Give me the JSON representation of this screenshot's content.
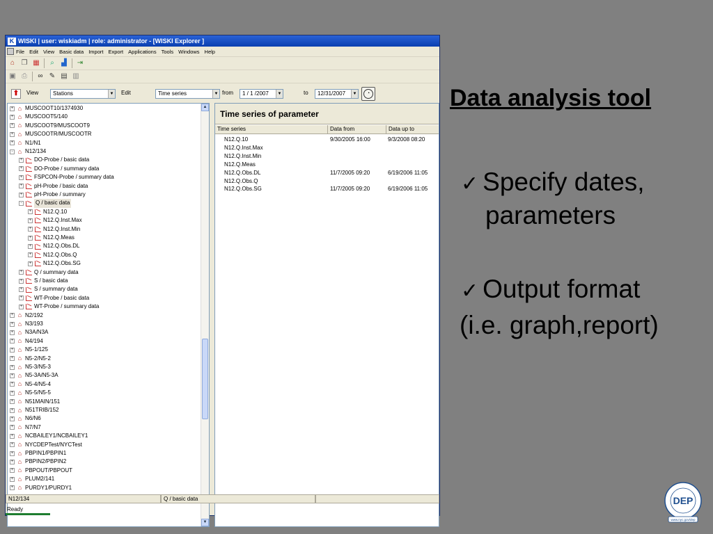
{
  "window": {
    "title": "WISKI | user: wiskiadm | role: administrator - [WISKI Explorer ]",
    "menu": [
      "File",
      "Edit",
      "View",
      "Basic data",
      "Import",
      "Export",
      "Applications",
      "Tools",
      "Windows",
      "Help"
    ]
  },
  "viewbar": {
    "view_label": "View",
    "view_value": "Stations",
    "edit_label": "Edit",
    "edit_value": "Time series",
    "from_label": "from",
    "from_value": "1 / 1 /2007",
    "to_label": "to",
    "to_value": "12/31/2007"
  },
  "tree": [
    {
      "label": "MUSCOOT10/1374930",
      "level": 0,
      "icon": "station",
      "exp": "+"
    },
    {
      "label": "MUSCOOT5/140",
      "level": 0,
      "icon": "station",
      "exp": "+"
    },
    {
      "label": "MUSCOOT9/MUSCOOT9",
      "level": 0,
      "icon": "station",
      "exp": "+"
    },
    {
      "label": "MUSCOOTR/MUSCOOTR",
      "level": 0,
      "icon": "station",
      "exp": "+"
    },
    {
      "label": "N1/N1",
      "level": 0,
      "icon": "station",
      "exp": "+"
    },
    {
      "label": "N12/134",
      "level": 0,
      "icon": "station",
      "exp": "-"
    },
    {
      "label": "DO-Probe / basic data",
      "level": 1,
      "icon": "series",
      "exp": "+"
    },
    {
      "label": "DO-Probe / summary data",
      "level": 1,
      "icon": "series",
      "exp": "+"
    },
    {
      "label": "FSPCON-Probe / summary data",
      "level": 1,
      "icon": "series",
      "exp": "+"
    },
    {
      "label": "pH-Probe / basic data",
      "level": 1,
      "icon": "series",
      "exp": "+"
    },
    {
      "label": "pH-Probe / summary",
      "level": 1,
      "icon": "series",
      "exp": "+"
    },
    {
      "label": "Q / basic data",
      "level": 1,
      "icon": "series",
      "exp": "-",
      "selected": true
    },
    {
      "label": "N12.Q.10",
      "level": 2,
      "icon": "series",
      "exp": "+"
    },
    {
      "label": "N12.Q.Inst.Max",
      "level": 2,
      "icon": "series",
      "exp": "+"
    },
    {
      "label": "N12.Q.Inst.Min",
      "level": 2,
      "icon": "series",
      "exp": "+"
    },
    {
      "label": "N12.Q.Meas",
      "level": 2,
      "icon": "series",
      "exp": "+"
    },
    {
      "label": "N12.Q.Obs.DL",
      "level": 2,
      "icon": "series",
      "exp": "+"
    },
    {
      "label": "N12.Q.Obs.Q",
      "level": 2,
      "icon": "series",
      "exp": "+"
    },
    {
      "label": "N12.Q.Obs.SG",
      "level": 2,
      "icon": "series",
      "exp": "+"
    },
    {
      "label": "Q / summary data",
      "level": 1,
      "icon": "series",
      "exp": "+"
    },
    {
      "label": "S / basic data",
      "level": 1,
      "icon": "series",
      "exp": "+"
    },
    {
      "label": "S / summary data",
      "level": 1,
      "icon": "series",
      "exp": "+"
    },
    {
      "label": "WT-Probe / basic data",
      "level": 1,
      "icon": "series",
      "exp": "+"
    },
    {
      "label": "WT-Probe / summary data",
      "level": 1,
      "icon": "series",
      "exp": "+"
    },
    {
      "label": "N2/192",
      "level": 0,
      "icon": "station",
      "exp": "+"
    },
    {
      "label": "N3/193",
      "level": 0,
      "icon": "station",
      "exp": "+"
    },
    {
      "label": "N3A/N3A",
      "level": 0,
      "icon": "station",
      "exp": "+"
    },
    {
      "label": "N4/194",
      "level": 0,
      "icon": "station",
      "exp": "+"
    },
    {
      "label": "N5-1/125",
      "level": 0,
      "icon": "station",
      "exp": "+"
    },
    {
      "label": "N5-2/N5-2",
      "level": 0,
      "icon": "station",
      "exp": "+"
    },
    {
      "label": "N5-3/N5-3",
      "level": 0,
      "icon": "station",
      "exp": "+"
    },
    {
      "label": "N5-3A/N5-3A",
      "level": 0,
      "icon": "station",
      "exp": "+"
    },
    {
      "label": "N5-4/N5-4",
      "level": 0,
      "icon": "station",
      "exp": "+"
    },
    {
      "label": "N5-5/N5-5",
      "level": 0,
      "icon": "station",
      "exp": "+"
    },
    {
      "label": "N51MAIN/151",
      "level": 0,
      "icon": "station",
      "exp": "+"
    },
    {
      "label": "N51TRIB/152",
      "level": 0,
      "icon": "station",
      "exp": "+"
    },
    {
      "label": "N6/N6",
      "level": 0,
      "icon": "station",
      "exp": "+"
    },
    {
      "label": "N7/N7",
      "level": 0,
      "icon": "station",
      "exp": "+"
    },
    {
      "label": "NCBAILEY1/NCBAILEY1",
      "level": 0,
      "icon": "station",
      "exp": "+"
    },
    {
      "label": "NYCDEPTest/NYCTest",
      "level": 0,
      "icon": "station",
      "exp": "+"
    },
    {
      "label": "PBPIN1/PBPIN1",
      "level": 0,
      "icon": "station",
      "exp": "+"
    },
    {
      "label": "PBPIN2/PBPIN2",
      "level": 0,
      "icon": "station",
      "exp": "+"
    },
    {
      "label": "PBPOUT/PBPOUT",
      "level": 0,
      "icon": "station",
      "exp": "+"
    },
    {
      "label": "PLUM2/141",
      "level": 0,
      "icon": "station",
      "exp": "+"
    },
    {
      "label": "PURDY1/PURDY1",
      "level": 0,
      "icon": "station",
      "exp": "+"
    }
  ],
  "panel": {
    "title": "Time series of parameter",
    "columns": [
      "Time series",
      "Data from",
      "Data up to"
    ],
    "rows": [
      {
        "name": "N12.Q.10",
        "from": "9/30/2005 16:00",
        "to": "9/3/2008 08:20"
      },
      {
        "name": "N12.Q.Inst.Max",
        "from": "",
        "to": ""
      },
      {
        "name": "N12.Q.Inst.Min",
        "from": "",
        "to": ""
      },
      {
        "name": "N12.Q.Meas",
        "from": "",
        "to": ""
      },
      {
        "name": "N12.Q.Obs.DL",
        "from": "11/7/2005 09:20",
        "to": "6/19/2006 11:05"
      },
      {
        "name": "N12.Q.Obs.Q",
        "from": "",
        "to": ""
      },
      {
        "name": "N12.Q.Obs.SG",
        "from": "11/7/2005 09:20",
        "to": "6/19/2006 11:05"
      }
    ]
  },
  "status": {
    "station": "N12/134",
    "series": "Q / basic data",
    "ready": "Ready"
  },
  "slide": {
    "title": "Data analysis tool",
    "bullet1_line1": "Specify dates,",
    "bullet1_line2": "parameters",
    "bullet2_line1": "Output format",
    "bullet2_line2": "(i.e. graph,report)",
    "check": "✓"
  },
  "logo": {
    "text": "DEP",
    "ring_text": "NEW YORK CITY DEPARTMENT OF ENVIRONMENTAL PROTECTION",
    "url": "www.nyc.gov/dep"
  }
}
